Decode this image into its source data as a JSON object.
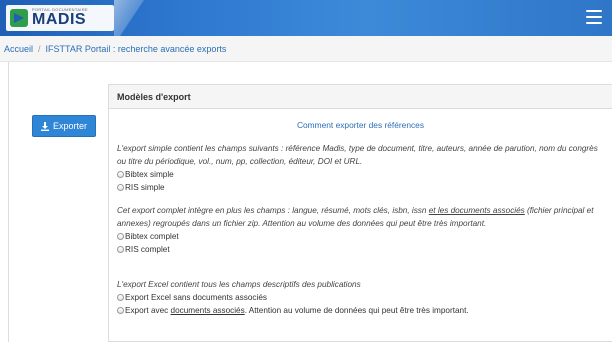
{
  "header": {
    "logo_small": "PORTAIL DOCUMENTAIRE",
    "logo_big": "MADIS"
  },
  "breadcrumb": {
    "home": "Accueil",
    "separator": "/",
    "current": "IFSTTAR Portail : recherche avancée exports"
  },
  "actions": {
    "export_label": "Exporter"
  },
  "panel": {
    "title": "Modèles d'export",
    "howto_link": "Comment exporter des références",
    "simple": {
      "desc": "L'export simple contient les champs suivants : référence Madis, type de document, titre, auteurs, année de parution, nom du congrès ou titre du périodique, vol., num, pp, collection, éditeur, DOI et URL.",
      "options": [
        "Bibtex simple",
        "RIS simple"
      ]
    },
    "complete": {
      "desc_a": "Cet export complet intègre en plus les champs : langue, résumé, mots clés, isbn, issn ",
      "desc_link": "et les documents associés",
      "desc_b": " (fichier principal et annexes) regroupés dans un fichier zip. Attention au volume des données qui peut être très important.",
      "options": [
        "Bibtex complet",
        "RIS complet"
      ]
    },
    "excel": {
      "desc": "L'export Excel contient tous les champs descriptifs des publications",
      "option1": "Export Excel sans documents associés",
      "option2_a": "Export avec ",
      "option2_link": "documents associés",
      "option2_b": ". Attention au volume de données qui peut être très important."
    }
  },
  "colors": {
    "header_blue": "#2e78d0",
    "button_blue": "#2f86d6",
    "link_blue": "#2a6fb7"
  },
  "icons": {
    "menu": "hamburger-icon",
    "export": "download-icon",
    "radio": "radio-unchecked"
  }
}
